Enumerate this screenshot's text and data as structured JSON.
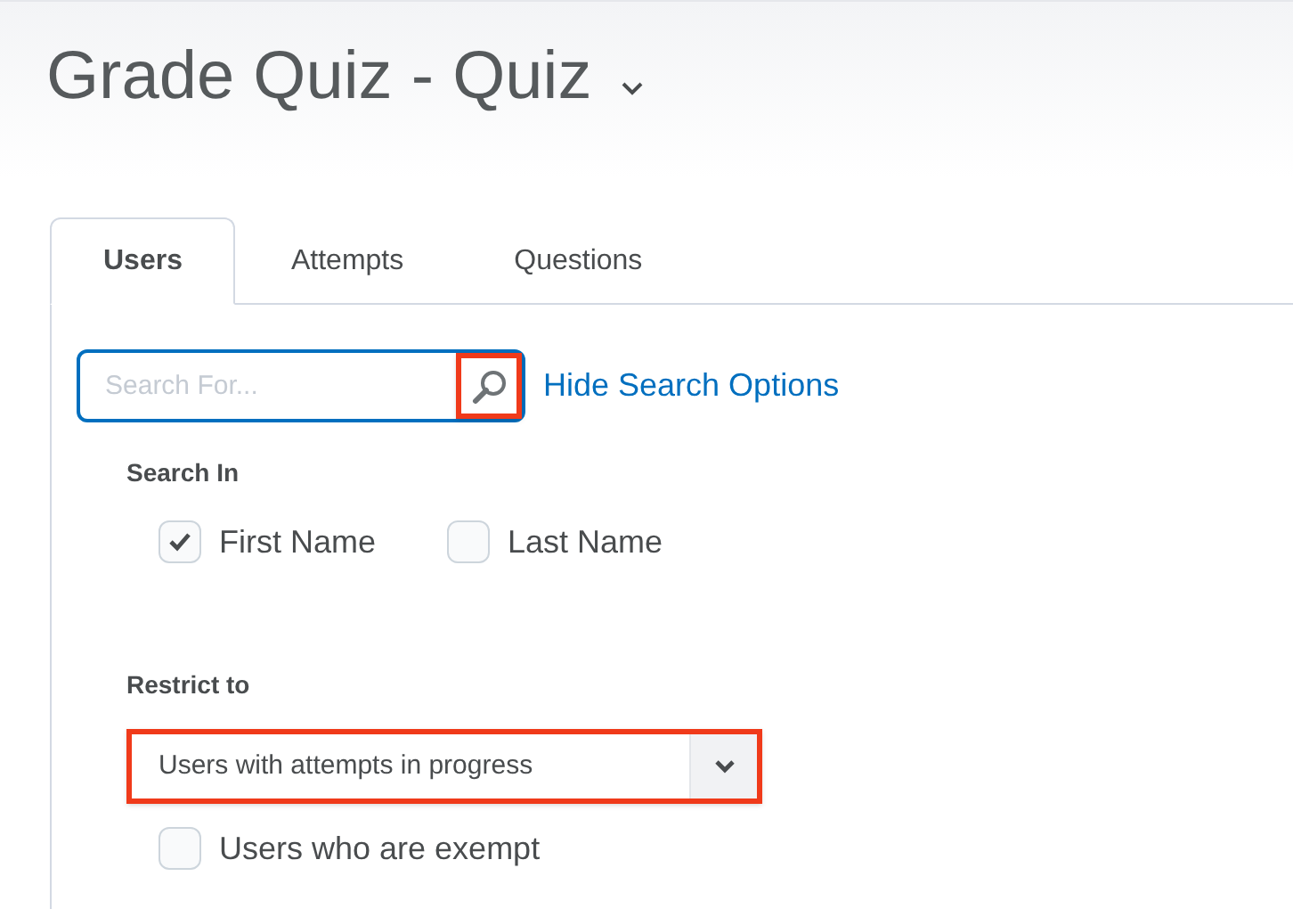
{
  "page": {
    "title": "Grade Quiz - Quiz"
  },
  "tabs": [
    {
      "label": "Users",
      "selected": true
    },
    {
      "label": "Attempts",
      "selected": false
    },
    {
      "label": "Questions",
      "selected": false
    }
  ],
  "search": {
    "placeholder": "Search For...",
    "button_highlighted": true,
    "options_link": "Hide Search Options"
  },
  "search_in": {
    "label": "Search In",
    "options": [
      {
        "label": "First Name",
        "checked": true
      },
      {
        "label": "Last Name",
        "checked": false
      }
    ]
  },
  "restrict": {
    "label": "Restrict to",
    "value": "Users with attempts in progress",
    "highlighted": true,
    "options": [
      {
        "label": "Users who are exempt",
        "checked": false
      }
    ]
  }
}
